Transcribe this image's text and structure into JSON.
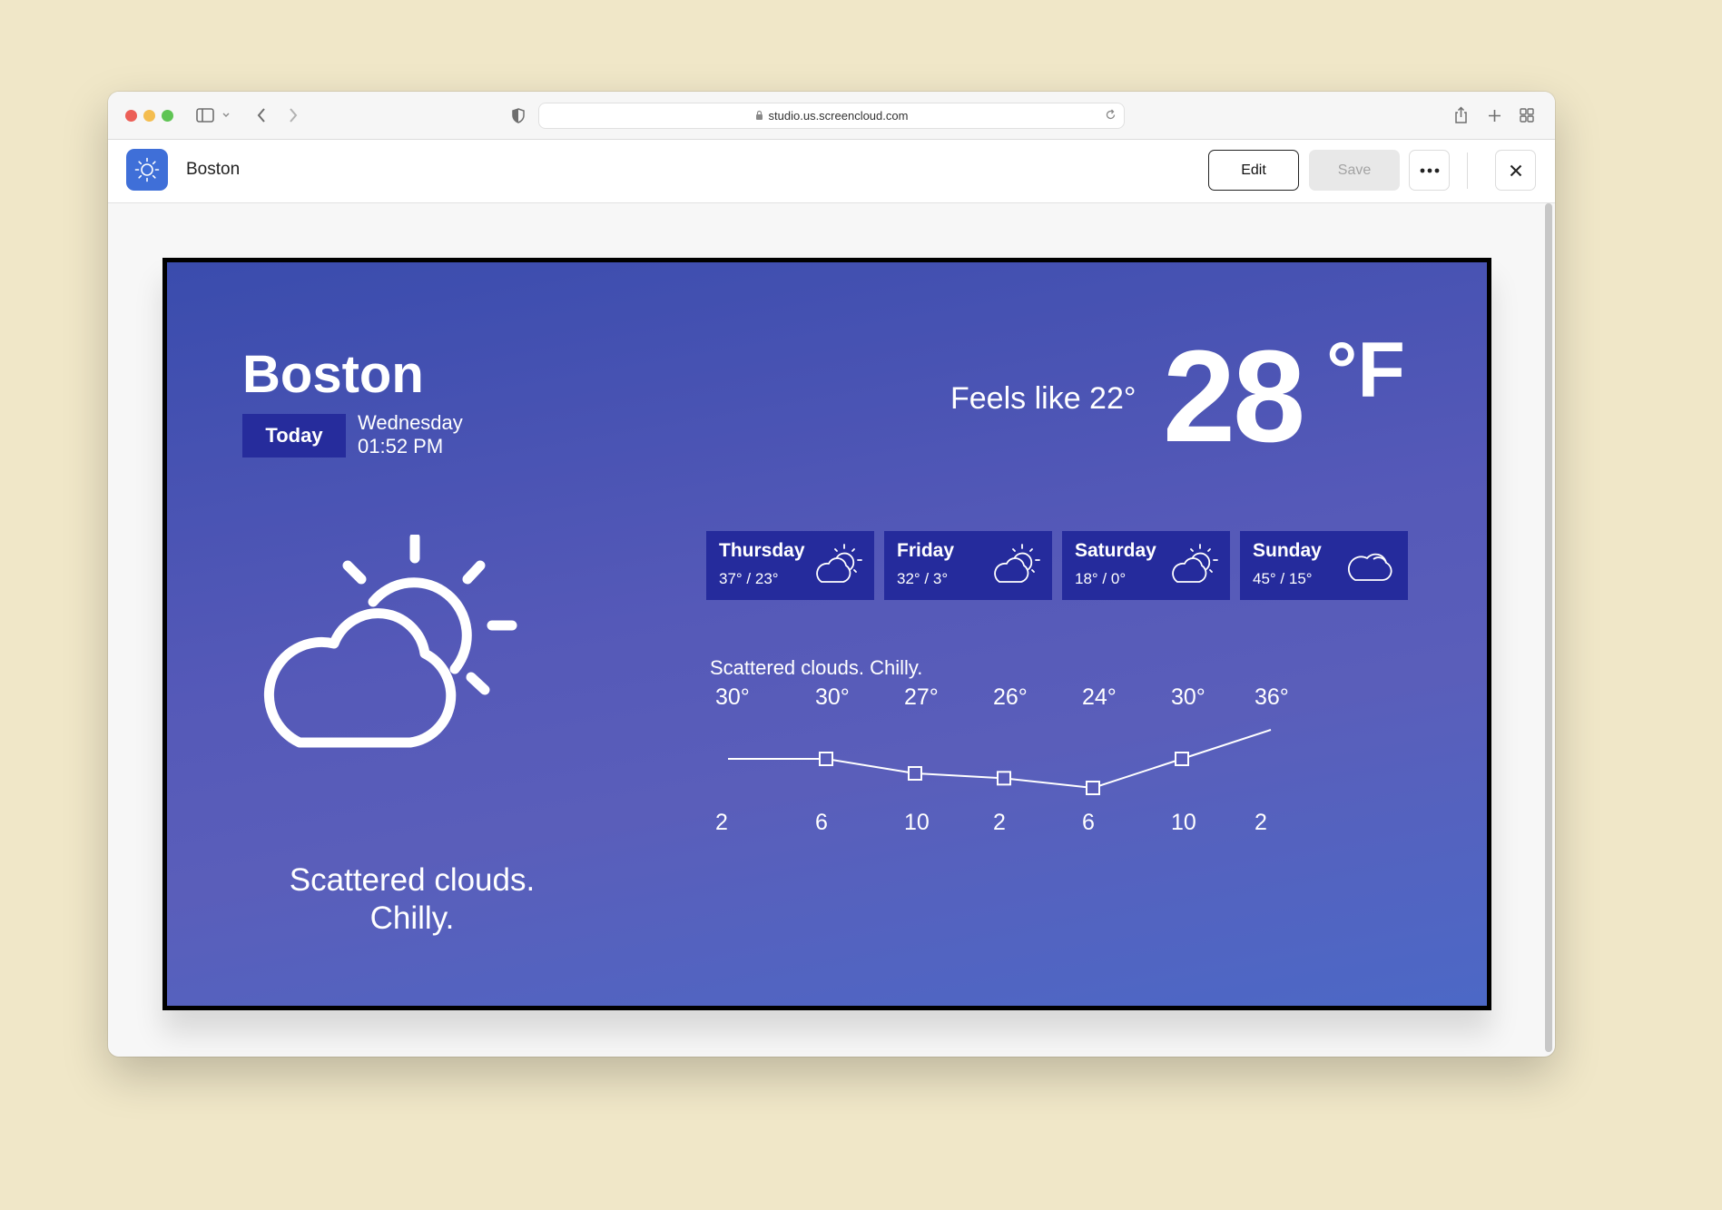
{
  "browser": {
    "url": "studio.us.screencloud.com",
    "icons": [
      "sidebar-toggle-icon",
      "chevron-down-icon",
      "back-icon",
      "forward-icon",
      "shield-icon",
      "lock-icon",
      "reload-icon",
      "share-icon",
      "new-tab-icon",
      "tab-overview-icon"
    ]
  },
  "app": {
    "title": "Boston",
    "edit_label": "Edit",
    "save_label": "Save",
    "accent": "#3f6fd8"
  },
  "weather": {
    "city": "Boston",
    "today_label": "Today",
    "day": "Wednesday",
    "time": "01:52 PM",
    "feels_like": "Feels like 22°",
    "temperature": "28",
    "unit": "°F",
    "description_line1": "Scattered clouds.",
    "description_line2": "Chilly.",
    "summary": "Scattered clouds. Chilly.",
    "forecast": [
      {
        "day": "Thursday",
        "temps": "37° / 23°",
        "icon": "partly-cloudy-icon"
      },
      {
        "day": "Friday",
        "temps": "32° / 3°",
        "icon": "partly-cloudy-icon"
      },
      {
        "day": "Saturday",
        "temps": "18° / 0°",
        "icon": "partly-cloudy-icon"
      },
      {
        "day": "Sunday",
        "temps": "45° / 15°",
        "icon": "cloud-icon"
      }
    ],
    "colors": {
      "card": "#252b9c",
      "badge": "#262c9c"
    }
  },
  "chart_data": {
    "type": "line",
    "x": [
      "2",
      "6",
      "10",
      "2",
      "6",
      "10",
      "2"
    ],
    "y": [
      30,
      30,
      27,
      26,
      24,
      30,
      36
    ],
    "labels": [
      "30°",
      "30°",
      "27°",
      "26°",
      "24°",
      "30°",
      "36°"
    ]
  }
}
